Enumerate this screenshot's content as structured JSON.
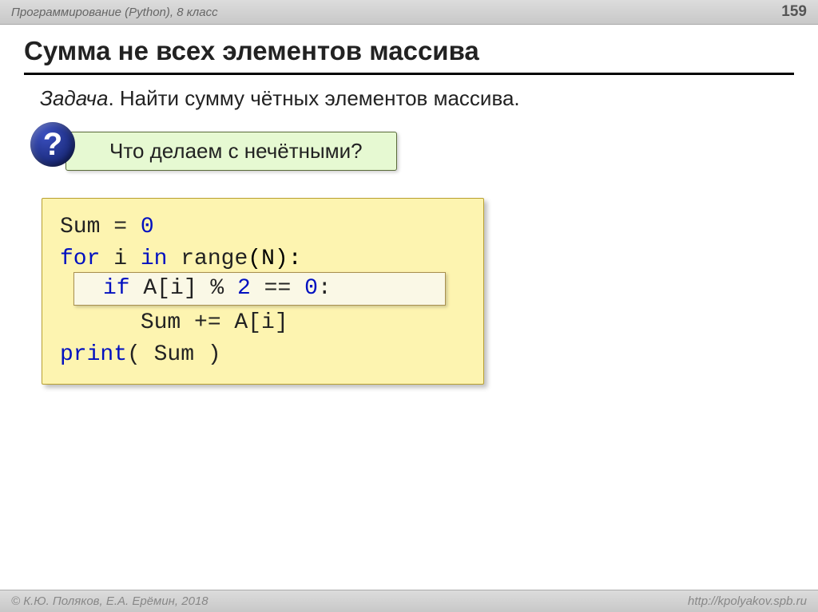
{
  "header": {
    "breadcrumb": "Программирование (Python), 8 класс",
    "page_number": "159"
  },
  "title": "Сумма не всех элементов массива",
  "task": {
    "label": "Задача",
    "text": ". Найти сумму чётных элементов массива."
  },
  "question": {
    "mark": "?",
    "text": "Что делаем с нечётными?"
  },
  "code": {
    "line1_a": "Sum = ",
    "line1_b": "0",
    "line2_a": "for",
    "line2_b": " i ",
    "line2_c": "in",
    "line2_d": " range",
    "line2_e": "(N):",
    "line3_a": "if",
    "line3_b": " A[i] % ",
    "line3_c": "2",
    "line3_d": " == ",
    "line3_e": "0",
    "line3_f": ":",
    "line4": "      Sum += A[i]",
    "line5_a": "print",
    "line5_b": "( Sum )"
  },
  "footer": {
    "copyright": "© К.Ю. Поляков, Е.А. Ерёмин, 2018",
    "url": "http://kpolyakov.spb.ru"
  }
}
